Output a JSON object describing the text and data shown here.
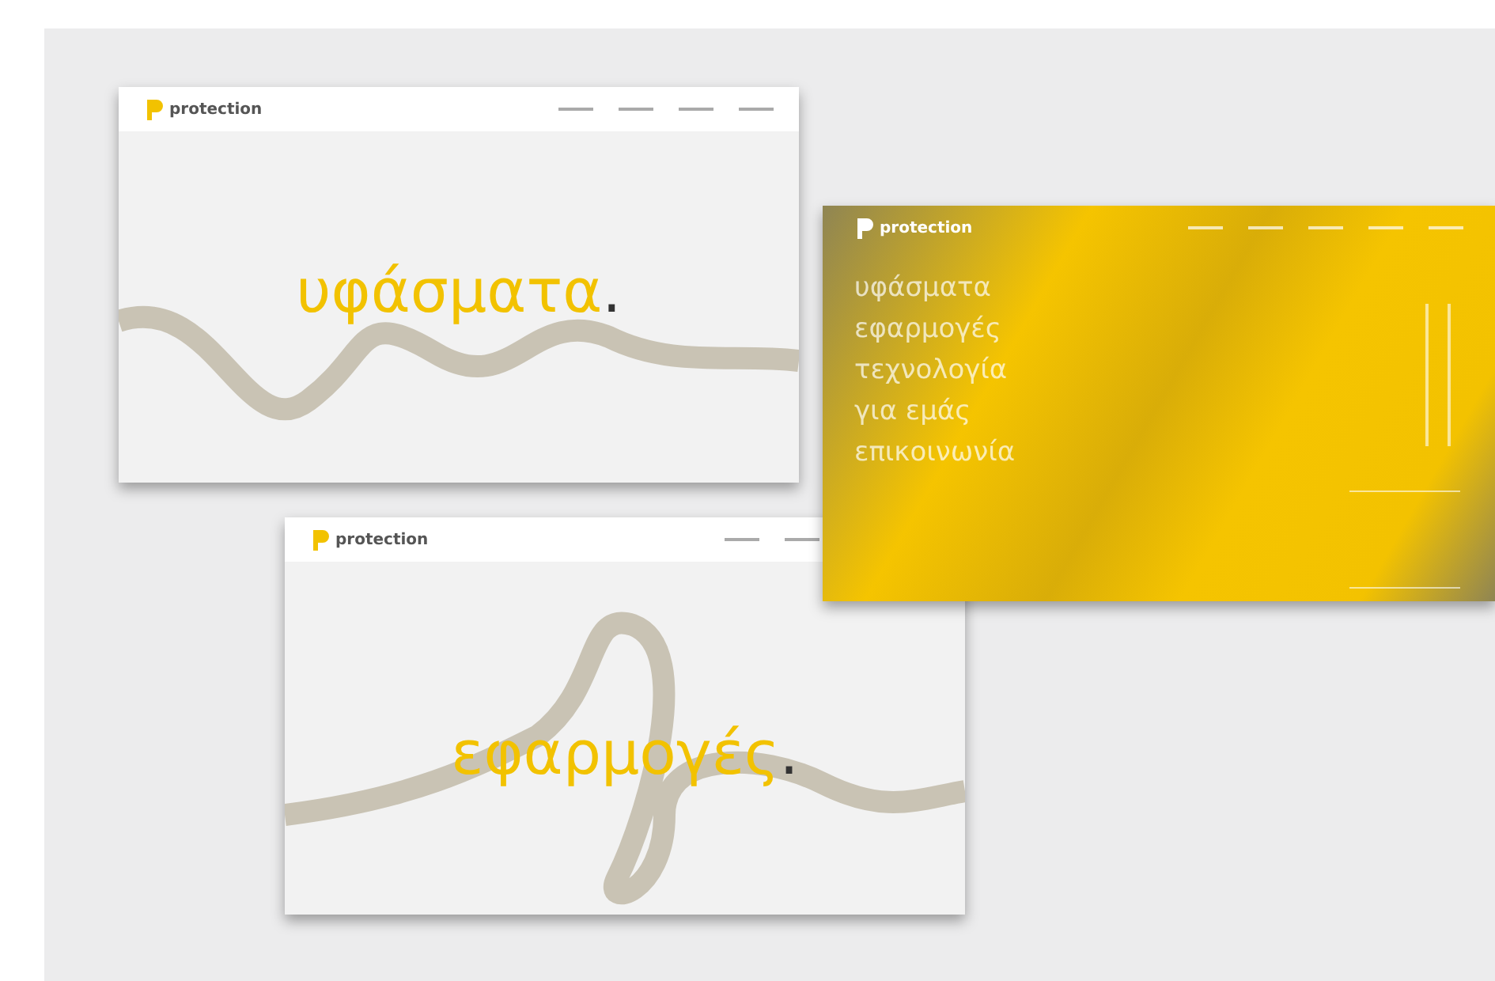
{
  "screens": [
    {
      "kind": "light",
      "logo": "protection",
      "headline": "υφάσματα",
      "dot": "."
    },
    {
      "kind": "light",
      "logo": "protection",
      "headline": "εφαρμογές",
      "dot": "."
    },
    {
      "kind": "yellow",
      "logo": "protection",
      "lines": [
        "υφάσματα",
        "εφαρμογές",
        "τεχνολογία",
        "για εμάς",
        "επικοινωνία"
      ]
    }
  ]
}
